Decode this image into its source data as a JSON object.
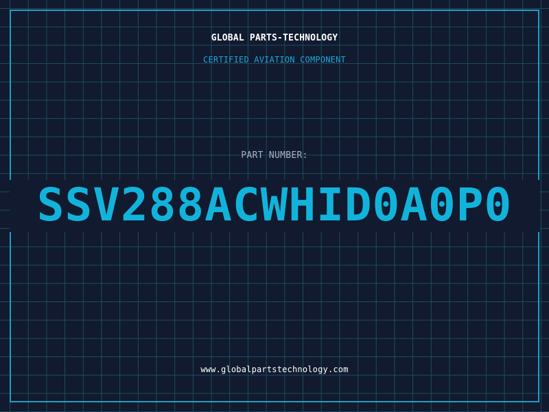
{
  "brand": {
    "name": "GLOBAL PARTS-TECHNOLOGY",
    "tagline": "CERTIFIED AVIATION COMPONENT",
    "website": "www.globalpartstechnology.com"
  },
  "part": {
    "label": "PART NUMBER:",
    "number": "SSV288ACWHID0A0P0"
  },
  "colors": {
    "background": "#111a2e",
    "grid": "#1d4c62",
    "frame": "#1f9ec7",
    "accent": "#12b3db",
    "label": "#a8b4c8",
    "text": "#ffffff"
  }
}
